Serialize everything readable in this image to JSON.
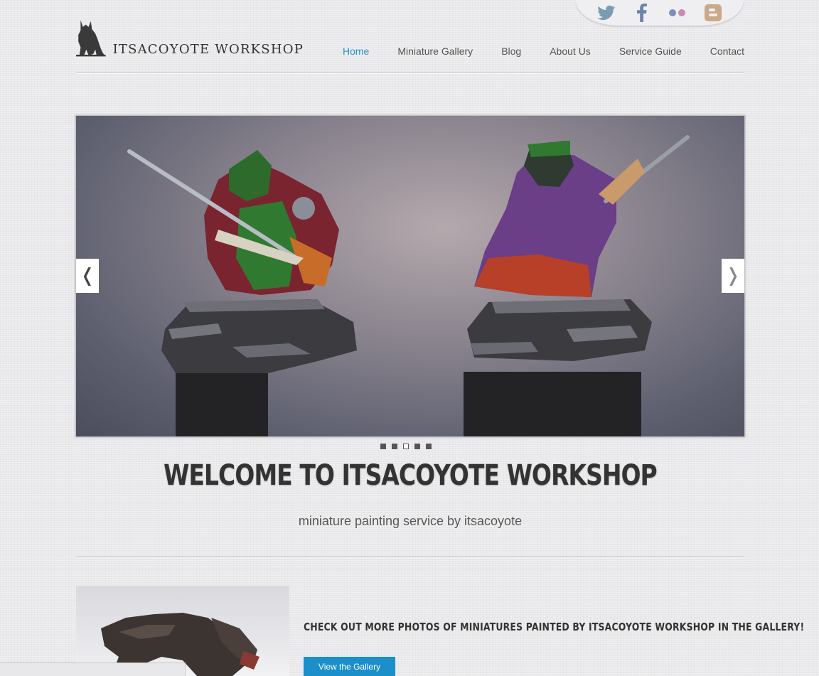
{
  "social": {
    "icons": [
      "twitter-icon",
      "facebook-icon",
      "flickr-icon",
      "blogger-icon"
    ],
    "colors": {
      "twitter": "#7a9cb2",
      "facebook": "#6d84a8",
      "flickr_blue": "#7d8fb8",
      "flickr_pink": "#c98ab0",
      "blogger": "#c9a98a"
    }
  },
  "logo": {
    "text": "ITSACOYOTE WORKSHOP"
  },
  "nav": {
    "items": [
      {
        "label": "Home",
        "active": true
      },
      {
        "label": "Miniature Gallery"
      },
      {
        "label": "Blog"
      },
      {
        "label": "About Us"
      },
      {
        "label": "Service Guide"
      },
      {
        "label": "Contact"
      }
    ],
    "active_color": "#2a92c8"
  },
  "slider": {
    "prev": "❬",
    "next": "❭",
    "dots": 5,
    "active_dot": 3
  },
  "hero": {
    "title": "WELCOME TO ITSACOYOTE WORKSHOP",
    "subtitle": "miniature painting service by itsacoyote"
  },
  "gallery_cta": {
    "text": "CHECK OUT MORE PHOTOS OF MINIATURES PAINTED BY ITSACOYOTE WORKSHOP IN THE GALLERY!",
    "button": "View the Gallery",
    "button_color": "#1a8fc9"
  }
}
